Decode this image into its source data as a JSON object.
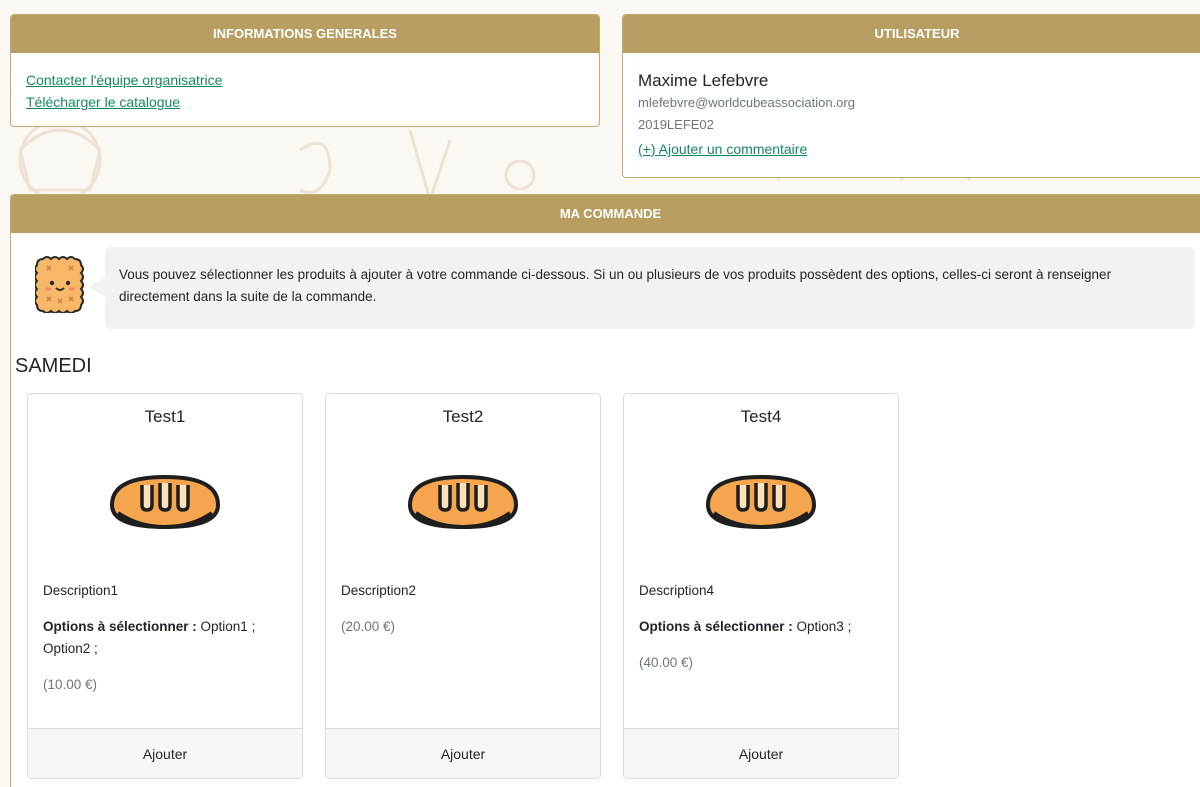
{
  "info": {
    "header": "INFORMATIONS GENERALES",
    "links": [
      "Contacter l'équipe organisatrice",
      "Télécharger le catalogue"
    ]
  },
  "user": {
    "header": "UTILISATEUR",
    "name": "Maxime Lefebvre",
    "email": "mlefebvre@worldcubeassociation.org",
    "wca_id": "2019LEFE02",
    "comment_link": "(+) Ajouter un commentaire"
  },
  "order": {
    "header": "MA COMMANDE",
    "hint": "Vous pouvez sélectionner les produits à ajouter à votre commande ci-dessous. Si un ou plusieurs de vos produits possèdent des options, celles-ci seront à renseigner directement dans la suite de la commande.",
    "day": "SAMEDI",
    "products": [
      {
        "name": "Test1",
        "description": "Description1",
        "options_label": "Options à sélectionner :",
        "options": " Option1 ; Option2 ;",
        "price": "(10.00 €)",
        "button": "Ajouter",
        "icon": "bread-icon"
      },
      {
        "name": "Test2",
        "description": "Description2",
        "options_label": "",
        "options": "",
        "price": "(20.00 €)",
        "button": "Ajouter",
        "icon": "bread-icon"
      },
      {
        "name": "Test4",
        "description": "Description4",
        "options_label": "Options à sélectionner :",
        "options": " Option3 ;",
        "price": "(40.00 €)",
        "button": "Ajouter",
        "icon": "bread-icon"
      }
    ]
  },
  "colors": {
    "header": "#b89f61",
    "link": "#138a5d",
    "bread": "#f5a54e"
  }
}
